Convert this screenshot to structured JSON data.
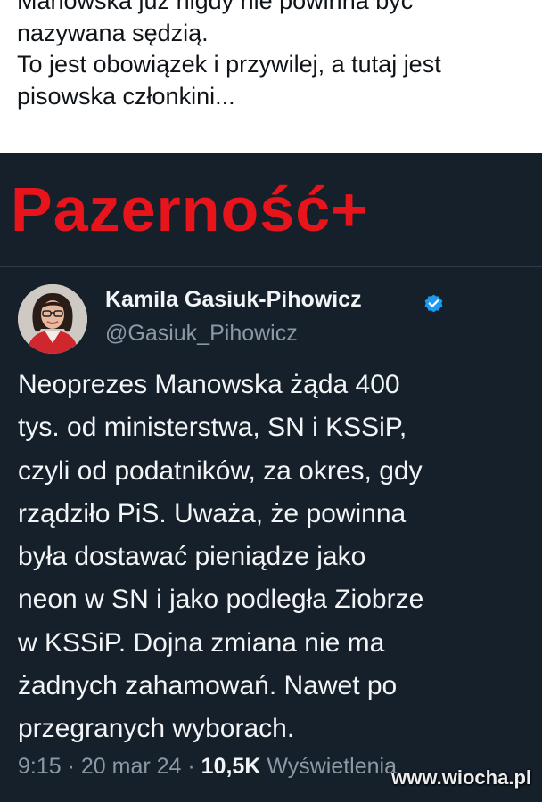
{
  "top_comment": {
    "lines": [
      "Manowska już nigdy nie powinna być",
      "nazywana sędzią.",
      "To jest obowiązek i przywilej, a tutaj jest",
      "pisowska członkini..."
    ]
  },
  "headline": "Pazerność+",
  "tweet": {
    "author_name": "Kamila Gasiuk-Pihowicz",
    "handle": "@Gasiuk_Pihowicz",
    "verified_icon": "verified-badge-icon",
    "lines": [
      "Neoprezes Manowska żąda 400",
      "tys. od ministerstwa, SN i KSSiP,",
      "czyli od podatników, za okres, gdy",
      "rządziło PiS. Uważa, że powinna",
      "była dostawać pieniądze jako",
      "neon w SN i jako podległa Ziobrze",
      "w KSSiP. Dojna zmiana nie ma",
      "żadnych zahamowań. Nawet po",
      "przegranych wyborach."
    ],
    "time": "9:15",
    "separator": " · ",
    "date": "20 mar 24",
    "views_count": "10,5K",
    "views_label": "Wyświetlenia"
  },
  "watermark": "www.wiocha.pl",
  "colors": {
    "headline": "#e8141c",
    "background_dark": "#15202b",
    "verified": "#1d9bf0",
    "muted": "#8b98a5"
  }
}
